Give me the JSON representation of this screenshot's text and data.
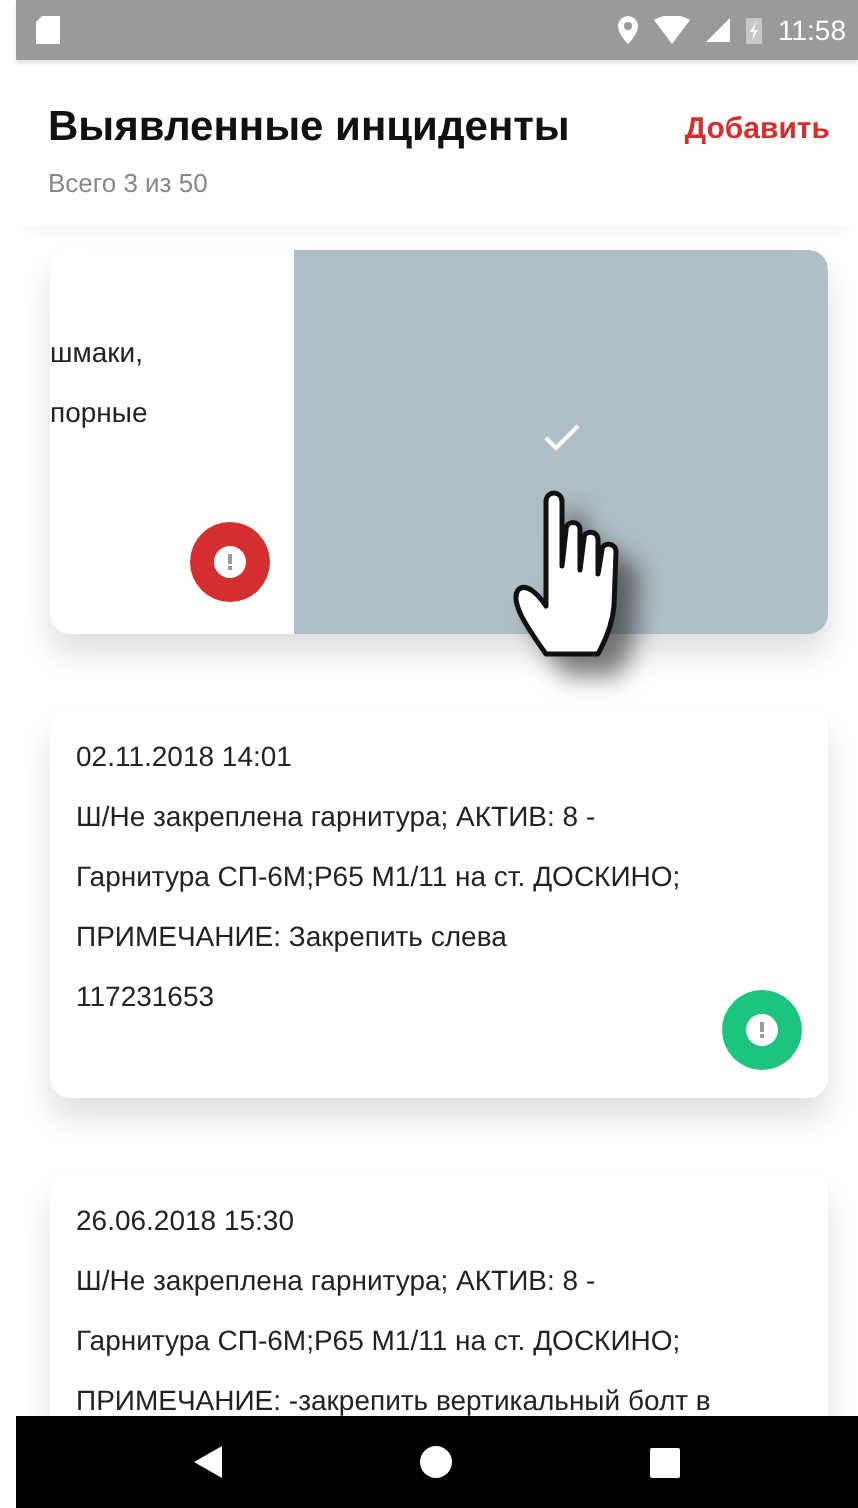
{
  "status_bar": {
    "time": "11:58"
  },
  "header": {
    "title": "Выявленные инциденты",
    "add_label": "Добавить",
    "subtitle": "Всего 3 из 50"
  },
  "incidents": [
    {
      "kind": "swiped",
      "lines": [
        "шмаки,",
        "порные"
      ],
      "color": "#d32f2f"
    },
    {
      "kind": "normal",
      "date": "02.11.2018 14:01",
      "lines": [
        "Ш/Не закреплена гарнитура; АКТИВ: 8 -",
        "Гарнитура СП-6М;Р65 М1/11 на ст. ДОСКИНО;",
        "ПРИМЕЧАНИЕ: Закрепить слева"
      ],
      "number": "117231653",
      "color": "#1dc47f"
    },
    {
      "kind": "normal",
      "date": "26.06.2018 15:30",
      "lines": [
        "Ш/Не закреплена гарнитура; АКТИВ: 8 -",
        "Гарнитура СП-6М;Р65 М1/11 на ст. ДОСКИНО;",
        "ПРИМЕЧАНИЕ: -закрепить вертикальный болт в"
      ]
    }
  ]
}
